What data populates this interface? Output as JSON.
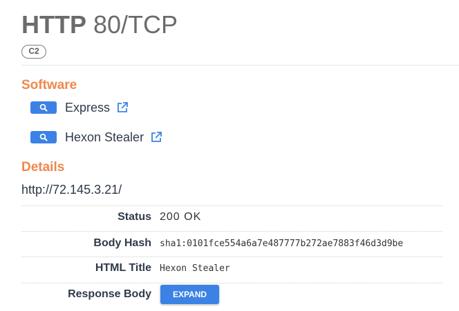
{
  "header": {
    "protocol": "HTTP",
    "port": "80/TCP",
    "tag": "C2"
  },
  "software": {
    "title": "Software",
    "items": [
      {
        "name": "Express",
        "icon": "search-icon",
        "link_icon": "external-link-icon"
      },
      {
        "name": "Hexon Stealer",
        "icon": "search-icon",
        "link_icon": "external-link-icon"
      }
    ]
  },
  "details": {
    "title": "Details",
    "url": "http://72.145.3.21/",
    "rows": [
      {
        "key": "Status",
        "value": "200 OK"
      },
      {
        "key": "Body Hash",
        "value": "sha1:0101fce554a6a7e487777b272ae7883f46d3d9be"
      },
      {
        "key": "HTML Title",
        "value": "Hexon Stealer"
      },
      {
        "key": "Response Body",
        "button": "EXPAND"
      }
    ]
  },
  "colors": {
    "accent": "#f0874a",
    "primary_button": "#3b82e4"
  }
}
